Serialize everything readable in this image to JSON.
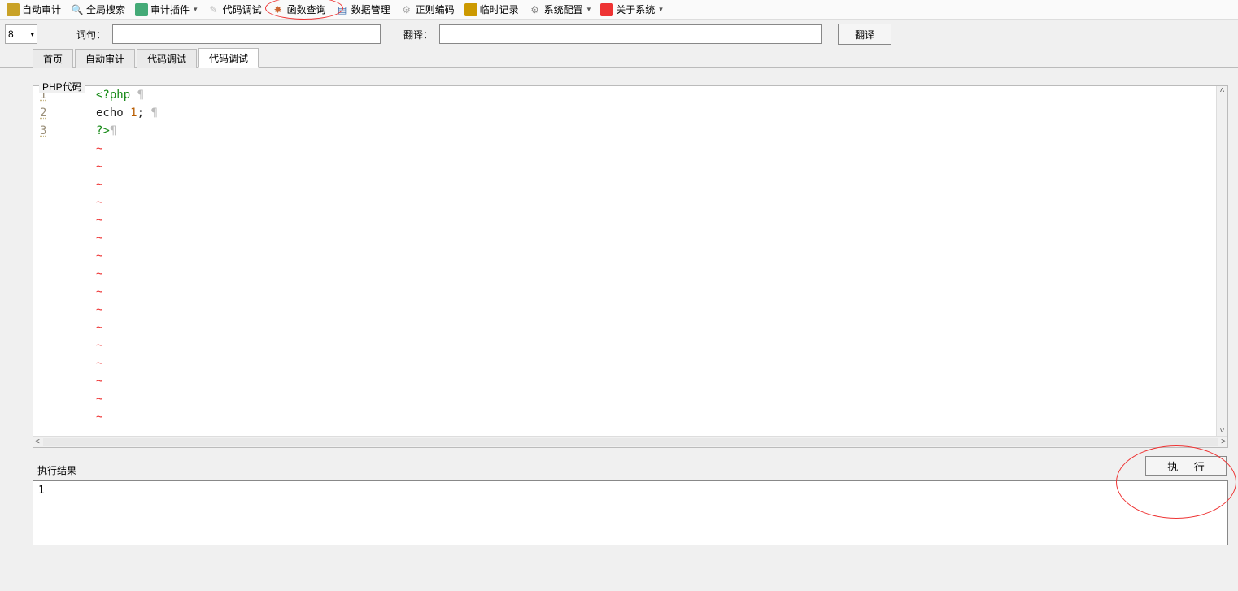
{
  "toolbar": {
    "auto_audit": "自动审计",
    "global_search": "全局搜索",
    "audit_plugin": "审计插件",
    "code_debug": "代码调试",
    "func_query": "函数查询",
    "data_manage": "数据管理",
    "regex_encode": "正则编码",
    "temp_record": "临时记录",
    "sys_config": "系统配置",
    "about_sys": "关于系统"
  },
  "searchbar": {
    "dropdown_value": "8",
    "term_label": "词句：",
    "trans_label": "翻译：",
    "translate_btn": "翻译"
  },
  "tabs": [
    "首页",
    "自动审计",
    "代码调试",
    "代码调试"
  ],
  "active_tab_index": 3,
  "editor": {
    "group_label": "PHP代码",
    "lines": [
      {
        "n": "1",
        "segments": [
          [
            "tag",
            "<?php"
          ],
          [
            "plain",
            " "
          ],
          [
            "pil",
            "¶"
          ]
        ]
      },
      {
        "n": "2",
        "segments": [
          [
            "plain",
            "echo "
          ],
          [
            "num",
            "1"
          ],
          [
            "plain",
            ";"
          ],
          [
            "plain",
            " "
          ],
          [
            "pil",
            "¶"
          ]
        ]
      },
      {
        "n": "3",
        "segments": [
          [
            "tag",
            "?>"
          ],
          [
            "pil",
            "¶"
          ]
        ]
      }
    ],
    "tilde_rows": 16
  },
  "exec": {
    "button": "执 行",
    "result_label": "执行结果",
    "result_text": "1"
  }
}
